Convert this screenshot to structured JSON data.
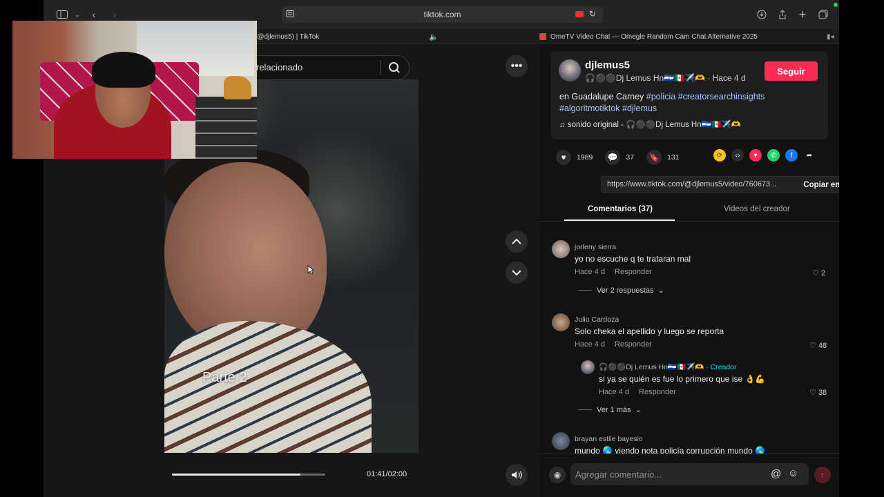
{
  "browser": {
    "url": "tiktok.com",
    "tabs": [
      {
        "label": "(@djlemus5) | TikTok"
      },
      {
        "label": "OmeTV Video Chat — Omegle Random Cam Chat Alternative 2025"
      }
    ]
  },
  "video": {
    "search_placeholder": "relacionado",
    "overlay_text": "Parte 2",
    "time": "01:41/02:00",
    "progress_fraction": 0.84
  },
  "post": {
    "username": "djlemus5",
    "display_name": "🎧⚫⚫Dj Lemus Hn🇸🇻🇲🇽✈️🫶",
    "posted": "Hace 4 d",
    "follow_label": "Seguir",
    "desc_prefix": "en Guadalupe Carney ",
    "hashtags": [
      "#policia",
      "#creatorsearchinsights",
      "#algoritmotiktok",
      "#djlemus"
    ],
    "sound_label": "sonido original - 🎧⚫⚫Dj Lemus Hn🇸🇻🇲🇽✈️🫶",
    "likes": "1989",
    "comments_count": "37",
    "saves": "131",
    "link": "https://www.tiktok.com/@djlemus5/video/760673...",
    "copy_label": "Copiar enlace"
  },
  "tabs": {
    "comments": "Comentarios (37)",
    "creator_videos": "Videos del creador"
  },
  "comments": [
    {
      "name": "jorleny sierra",
      "text": "yo no escuche q te trataran mal",
      "time": "Hace 4 d",
      "reply": "Responder",
      "likes": "2",
      "more": "Ver 2 respuestas"
    },
    {
      "name": "Julio Cardoza",
      "text": "Solo cheka el apellido y luego se reporta",
      "time": "Hace 4 d",
      "reply": "Responder",
      "likes": "48"
    },
    {
      "name": "🎧⚫⚫Dj Lemus Hn🇸🇻🇲🇽✈️🫶",
      "creator_label": "Creador",
      "text": "si ya se quién es fue lo primero que ise 👌💪",
      "time": "Hace 4 d",
      "reply": "Responder",
      "likes": "38",
      "more": "Ver 1 más"
    },
    {
      "name": "brayan estile bayesio",
      "text": "mundo 🌎 viendo nota policía corrupción mundo 🌎"
    }
  ],
  "composer": {
    "placeholder": "Agregar comentario..."
  },
  "colors": {
    "accent": "#fe2c55",
    "hashtag": "#a7c4ff",
    "creator": "#20d5ec"
  }
}
